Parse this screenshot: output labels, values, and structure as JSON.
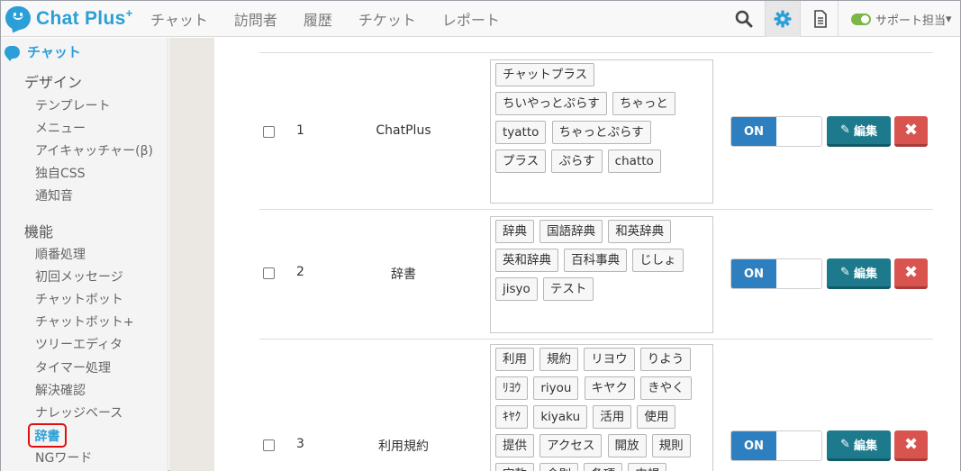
{
  "app": {
    "brand": "Chat Plus",
    "brand_sup": "+"
  },
  "nav": [
    "チャット",
    "訪問者",
    "履歴",
    "チケット",
    "レポート"
  ],
  "status": {
    "label": "サポート担当",
    "caret": "▾"
  },
  "sidebar": {
    "header": "チャット",
    "section_design": "デザイン",
    "design_items": [
      "テンプレート",
      "メニュー",
      "アイキャッチャー(β)",
      "独自CSS",
      "通知音"
    ],
    "section_features": "機能",
    "feature_items": [
      "順番処理",
      "初回メッセージ",
      "チャットボット",
      "チャットボット+",
      "ツリーエディタ",
      "タイマー処理",
      "解決確認",
      "ナレッジベース"
    ],
    "active_item": "辞書",
    "after_active": "NGワード"
  },
  "rows": [
    {
      "num": "1",
      "name": "ChatPlus",
      "tags": [
        "チャットプラス",
        "ちいやっとぷらす",
        "ちゃっと",
        "tyatto",
        "ちゃっとぷらす",
        "プラス",
        "ぷらす",
        "chatto"
      ],
      "on_label": "ON",
      "edit_label": "編集",
      "delete_label": "✖"
    },
    {
      "num": "2",
      "name": "辞書",
      "tags": [
        "辞典",
        "国語辞典",
        "和英辞典",
        "英和辞典",
        "百科事典",
        "じしょ",
        "jisyo",
        "テスト"
      ],
      "on_label": "ON",
      "edit_label": "編集",
      "delete_label": "✖"
    },
    {
      "num": "3",
      "name": "利用規約",
      "tags": [
        "利用",
        "規約",
        "リヨウ",
        "りよう",
        "ﾘﾖｳ",
        "riyou",
        "キヤク",
        "きやく",
        "ｷﾔｸ",
        "kiyaku",
        "活用",
        "使用",
        "提供",
        "アクセス",
        "開放",
        "規則",
        "定款",
        "会則",
        "条項",
        "内規"
      ],
      "on_label": "ON",
      "edit_label": "編集",
      "delete_label": "✖"
    }
  ]
}
